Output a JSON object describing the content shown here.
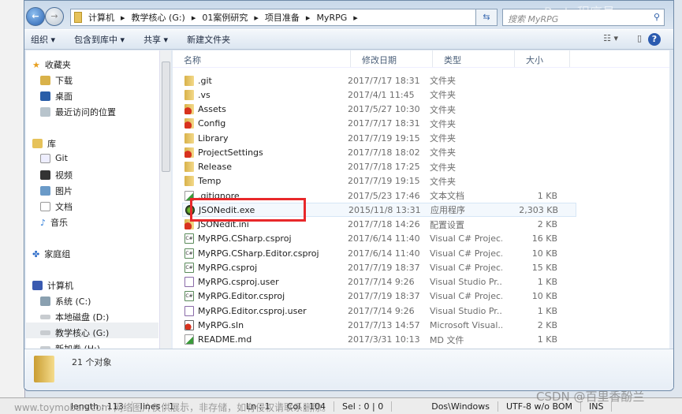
{
  "address": {
    "crumbs": [
      "计算机",
      "教学核心 (G:)",
      "01案例研究",
      "项目准备",
      "MyRPG"
    ],
    "search_placeholder": "搜索 MyRPG"
  },
  "toolbar": {
    "organize": "组织 ▾",
    "include_library": "包含到库中 ▾",
    "share": "共享 ▾",
    "new_folder": "新建文件夹"
  },
  "nav": {
    "favorites": {
      "label": "收藏夹",
      "items": [
        "下载",
        "桌面",
        "最近访问的位置"
      ]
    },
    "libraries": {
      "label": "库",
      "items": [
        "Git",
        "视频",
        "图片",
        "文档",
        "音乐"
      ]
    },
    "homegroup": {
      "label": "家庭组"
    },
    "computer": {
      "label": "计算机",
      "items": [
        "系统 (C:)",
        "本地磁盘 (D:)",
        "教学核心 (G:)",
        "新加卷 (H:)"
      ]
    }
  },
  "columns": {
    "name": "名称",
    "date": "修改日期",
    "type": "类型",
    "size": "大小"
  },
  "files": [
    {
      "name": ".git",
      "date": "2017/7/17 18:31",
      "type": "文件夹",
      "size": "",
      "icon": "folder"
    },
    {
      "name": ".vs",
      "date": "2017/4/1 11:45",
      "type": "文件夹",
      "size": "",
      "icon": "folder"
    },
    {
      "name": "Assets",
      "date": "2017/5/27 10:30",
      "type": "文件夹",
      "size": "",
      "icon": "svn"
    },
    {
      "name": "Config",
      "date": "2017/7/17 18:31",
      "type": "文件夹",
      "size": "",
      "icon": "svn"
    },
    {
      "name": "Library",
      "date": "2017/7/19 19:15",
      "type": "文件夹",
      "size": "",
      "icon": "folder"
    },
    {
      "name": "ProjectSettings",
      "date": "2017/7/18 18:02",
      "type": "文件夹",
      "size": "",
      "icon": "svn"
    },
    {
      "name": "Release",
      "date": "2017/7/18 17:25",
      "type": "文件夹",
      "size": "",
      "icon": "folder"
    },
    {
      "name": "Temp",
      "date": "2017/7/19 19:15",
      "type": "文件夹",
      "size": "",
      "icon": "folder"
    },
    {
      "name": ".gitignore",
      "date": "2017/5/23 17:46",
      "type": "文本文档",
      "size": "1 KB",
      "icon": "txt"
    },
    {
      "name": "JSONedit.exe",
      "date": "2015/11/8 13:31",
      "type": "应用程序",
      "size": "2,303 KB",
      "icon": "exe"
    },
    {
      "name": "JSONedit.ini",
      "date": "2017/7/18 14:26",
      "type": "配置设置",
      "size": "2 KB",
      "icon": "svn"
    },
    {
      "name": "MyRPG.CSharp.csproj",
      "date": "2017/6/14 11:40",
      "type": "Visual C# Projec...",
      "size": "16 KB",
      "icon": "cs"
    },
    {
      "name": "MyRPG.CSharp.Editor.csproj",
      "date": "2017/6/14 11:40",
      "type": "Visual C# Projec...",
      "size": "10 KB",
      "icon": "cs"
    },
    {
      "name": "MyRPG.csproj",
      "date": "2017/7/19 18:37",
      "type": "Visual C# Projec...",
      "size": "15 KB",
      "icon": "cs"
    },
    {
      "name": "MyRPG.csproj.user",
      "date": "2017/7/14 9:26",
      "type": "Visual Studio Pr...",
      "size": "1 KB",
      "icon": "user"
    },
    {
      "name": "MyRPG.Editor.csproj",
      "date": "2017/7/19 18:37",
      "type": "Visual C# Projec...",
      "size": "10 KB",
      "icon": "cs"
    },
    {
      "name": "MyRPG.Editor.csproj.user",
      "date": "2017/7/14 9:26",
      "type": "Visual Studio Pr...",
      "size": "1 KB",
      "icon": "user"
    },
    {
      "name": "MyRPG.sln",
      "date": "2017/7/13 14:57",
      "type": "Microsoft Visual...",
      "size": "2 KB",
      "icon": "sln"
    },
    {
      "name": "README.md",
      "date": "2017/3/31 10:13",
      "type": "MD 文件",
      "size": "1 KB",
      "icon": "txt"
    }
  ],
  "details": {
    "count": "21 个对象"
  },
  "notepad_status": {
    "length": "length : 113",
    "lines": "lines : 1",
    "ln": "Ln : 1",
    "col": "Col : 104",
    "sel": "Sel : 0 | 0",
    "eol": "Dos\\Windows",
    "encoding": "UTF-8 w/o BOM",
    "mode": "INS"
  },
  "watermarks": {
    "csdn": "CSDN @百里香酚兰",
    "toymoban": "www.toymoban.com 网络图片仅供展示，非存储，如有侵权请联系删除。",
    "top": "Prato程序员"
  },
  "colors": {
    "highlight_box": "#e8282a",
    "selected_drive": "#eceff2"
  }
}
